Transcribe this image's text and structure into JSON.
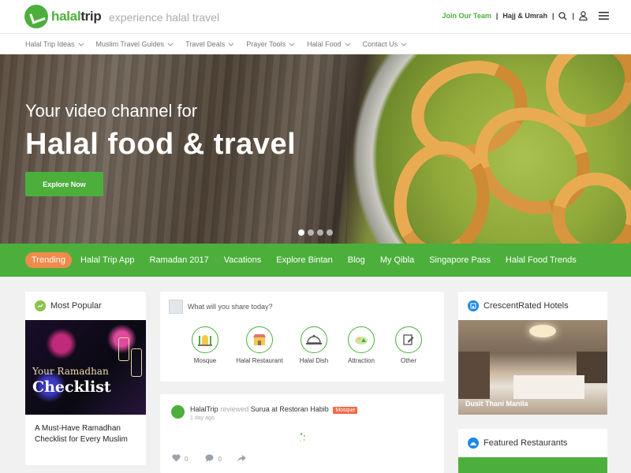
{
  "header": {
    "logo_text_1": "halal",
    "logo_text_2": "trip",
    "tagline": "experience halal travel",
    "join_label": "Join Our Team",
    "hajj_label": "Hajj & Umrah"
  },
  "menu": [
    {
      "label": "Halal Trip Ideas"
    },
    {
      "label": "Muslim Travel Guides"
    },
    {
      "label": "Travel Deals"
    },
    {
      "label": "Prayer Tools"
    },
    {
      "label": "Halal Food"
    },
    {
      "label": "Contact Us"
    }
  ],
  "hero": {
    "title_line1": "Your video channel for",
    "title_line2": "Halal food & travel",
    "cta": "Explore Now"
  },
  "tabs": [
    {
      "label": "Trending"
    },
    {
      "label": "Halal Trip App"
    },
    {
      "label": "Ramadan 2017"
    },
    {
      "label": "Vacations"
    },
    {
      "label": "Explore Bintan"
    },
    {
      "label": "Blog"
    },
    {
      "label": "My Qibla"
    },
    {
      "label": "Singapore Pass"
    },
    {
      "label": "Halal Food Trends"
    }
  ],
  "popular": {
    "heading": "Most Popular",
    "image_text_1": "Your Ramadhan",
    "image_text_2": "Checklist",
    "article_title": "A Must-Have Ramadhan Checklist for Every Muslim"
  },
  "share": {
    "prompt": "What will you share today?",
    "categories": [
      {
        "label": "Mosque"
      },
      {
        "label": "Halal Restaurant"
      },
      {
        "label": "Halal Dish"
      },
      {
        "label": "Attraction"
      },
      {
        "label": "Other"
      }
    ]
  },
  "feed": {
    "author": "HalalTrip",
    "action": "reviewed",
    "target": "Surua at Restoran Habib",
    "badge": "Mosque",
    "time": "1 day ago",
    "likes": "0",
    "comments": "0"
  },
  "hotels": {
    "heading": "CrescentRated Hotels",
    "caption": "Dusit Thani Manila"
  },
  "restaurants": {
    "heading": "Featured Restaurants"
  },
  "colors": {
    "brand_green": "#4caf3c",
    "trending_orange": "#f08a4b",
    "badge_red": "#f06a4b"
  }
}
